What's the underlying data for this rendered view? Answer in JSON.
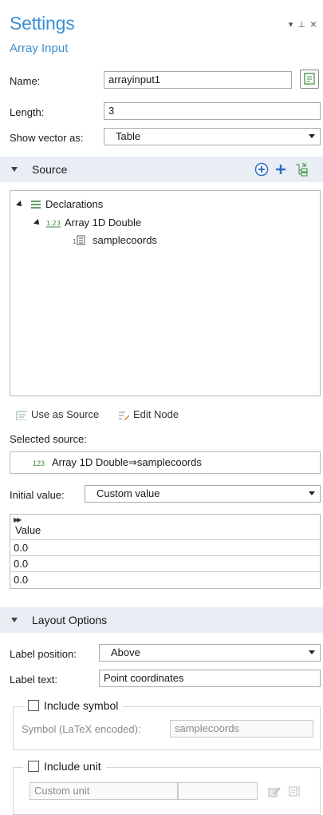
{
  "window": {
    "title": "Settings",
    "subtitle": "Array Input",
    "dropdown_glyph": "▾",
    "pin_glyph": "⊥",
    "close_glyph": "×"
  },
  "form": {
    "name_label": "Name:",
    "name_value": "arrayinput1",
    "length_label": "Length:",
    "length_value": "3",
    "show_vector_label": "Show vector as:",
    "show_vector_value": "Table"
  },
  "source": {
    "header": "Source",
    "tree": [
      {
        "label": "Declarations",
        "icon": "list-icon"
      },
      {
        "label": "Array 1D Double",
        "icon": "array-icon"
      },
      {
        "label": "samplecoords",
        "icon": "vector-icon"
      }
    ],
    "use_as_source": "Use as Source",
    "edit_node": "Edit Node",
    "selected_source_label": "Selected source:",
    "selected_source_prefix": "123",
    "selected_source_value": "Array 1D Double⇒samplecoords",
    "initial_value_label": "Initial value:",
    "initial_value_value": "Custom value",
    "table": {
      "header": "Value",
      "rows": [
        "0.0",
        "0.0",
        "0.0"
      ]
    }
  },
  "layout": {
    "header": "Layout Options",
    "label_position_label": "Label position:",
    "label_position_value": "Above",
    "label_text_label": "Label text:",
    "label_text_value": "Point coordinates",
    "include_symbol_label": "Include symbol",
    "symbol_label": "Symbol (LaTeX encoded):",
    "symbol_value": "samplecoords",
    "include_unit_label": "Include unit",
    "custom_unit_placeholder": "Custom unit"
  },
  "colors": {
    "accent": "#3c8fd1",
    "section_bg": "#e9eef5"
  }
}
